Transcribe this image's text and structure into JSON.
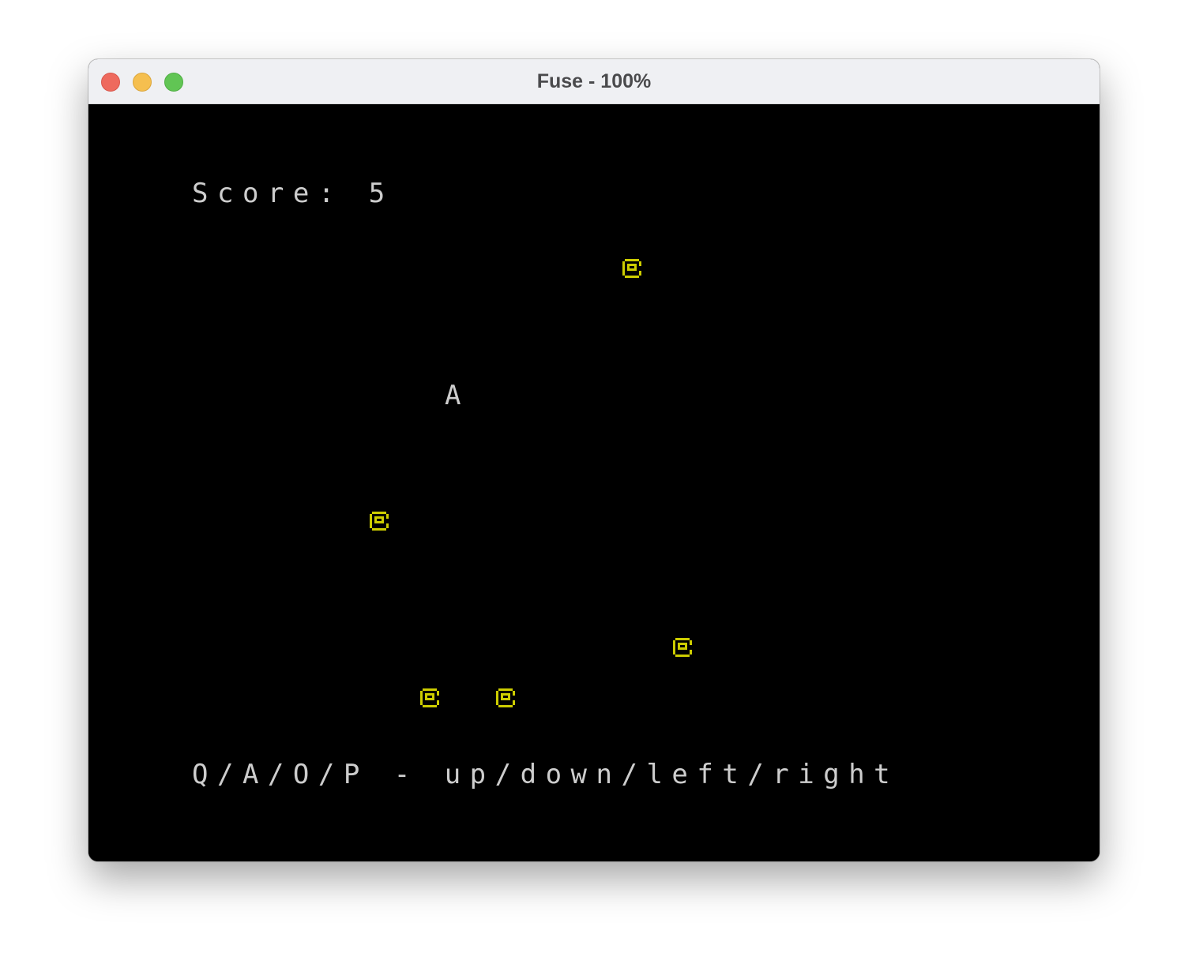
{
  "window": {
    "title": "Fuse - 100%"
  },
  "game": {
    "score_text": "Score: 5",
    "player_char": "A",
    "help_text": "Q/A/O/P - up/down/left/right",
    "colors": {
      "background": "#000000",
      "text": "#cdcdcd",
      "coin": "#cdcd00"
    },
    "coin_icon": "coin-icon",
    "coin_count": 5
  }
}
